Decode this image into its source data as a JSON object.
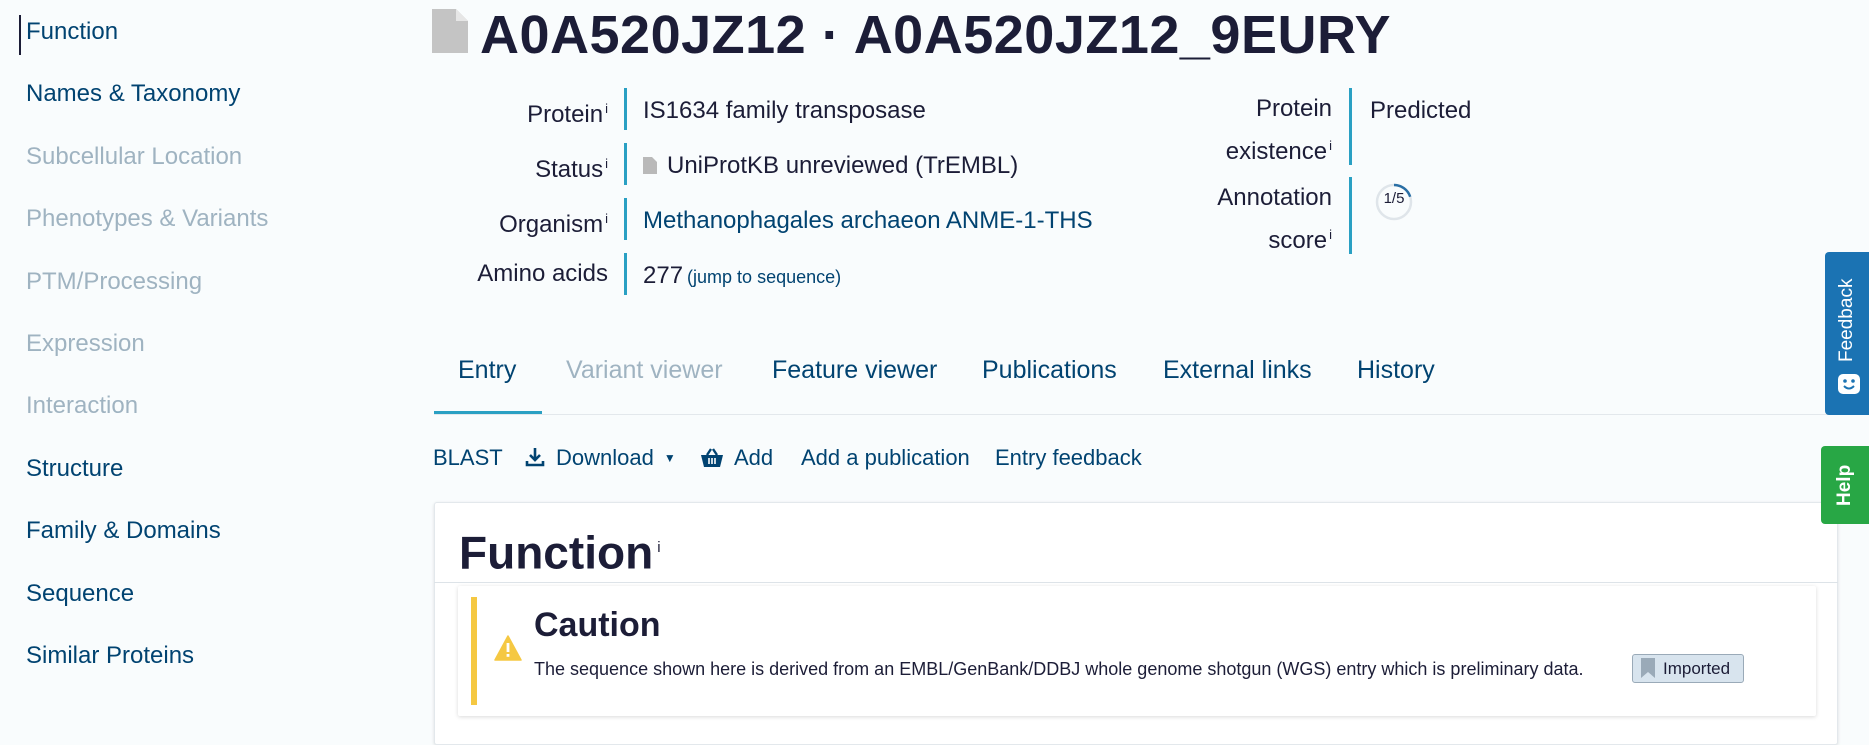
{
  "sidebar": {
    "items": [
      {
        "label": "Function",
        "enabled": true
      },
      {
        "label": "Names & Taxonomy",
        "enabled": true
      },
      {
        "label": "Subcellular Location",
        "enabled": false
      },
      {
        "label": "Phenotypes & Variants",
        "enabled": false
      },
      {
        "label": "PTM/Processing",
        "enabled": false
      },
      {
        "label": "Expression",
        "enabled": false
      },
      {
        "label": "Interaction",
        "enabled": false
      },
      {
        "label": "Structure",
        "enabled": true
      },
      {
        "label": "Family & Domains",
        "enabled": true
      },
      {
        "label": "Sequence",
        "enabled": true
      },
      {
        "label": "Similar Proteins",
        "enabled": true
      }
    ]
  },
  "header": {
    "title": "A0A520JZ12 · A0A520JZ12_9EURY"
  },
  "info": {
    "protein_label": "Protein",
    "protein_value": "IS1634 family transposase",
    "status_label": "Status",
    "status_value": "UniProtKB unreviewed (TrEMBL)",
    "organism_label": "Organism",
    "organism_value": "Methanophagales archaeon ANME-1-THS",
    "amino_acids_label": "Amino acids",
    "amino_acids_value": "277",
    "jump_link": "(jump to sequence)",
    "existence_label_1": "Protein",
    "existence_label_2": "existence",
    "existence_value": "Predicted",
    "annotation_label_1": "Annotation",
    "annotation_label_2": "score",
    "annotation_score": "1/5",
    "annotation_fraction": 0.2,
    "info_marker": "i"
  },
  "tabs": [
    {
      "label": "Entry",
      "active": true
    },
    {
      "label": "Variant viewer",
      "active": false
    },
    {
      "label": "Feature viewer",
      "active": false
    },
    {
      "label": "Publications",
      "active": false
    },
    {
      "label": "External links",
      "active": false
    },
    {
      "label": "History",
      "active": false
    }
  ],
  "toolbar": {
    "blast": "BLAST",
    "download": "Download",
    "add": "Add",
    "add_publication": "Add a publication",
    "entry_feedback": "Entry feedback"
  },
  "function_section": {
    "title": "Function",
    "info_marker": "i",
    "caution_title": "Caution",
    "caution_text": "The sequence shown here is derived from an EMBL/GenBank/DDBJ whole genome shotgun (WGS) entry which is preliminary data.",
    "badge": "Imported"
  },
  "side_buttons": {
    "feedback": "Feedback",
    "help": "Help"
  },
  "colors": {
    "link": "#014371",
    "disabled": "#9fb3c1",
    "accent": "#2aa0c3",
    "text": "#1c1d37",
    "caution": "#f5c842",
    "feedback": "#1b73b3",
    "help": "#28a745"
  }
}
